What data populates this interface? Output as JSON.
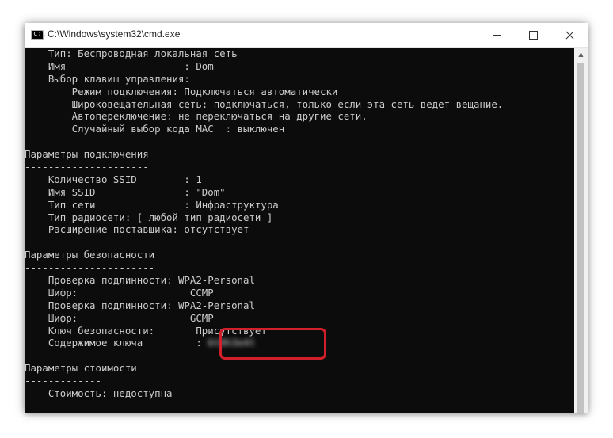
{
  "window": {
    "title": "C:\\Windows\\system32\\cmd.exe",
    "app_icon_glyph": "c:\\",
    "controls": {
      "minimize_icon": "minimize-icon",
      "maximize_icon": "maximize-icon",
      "close_icon": "close-icon"
    }
  },
  "console": {
    "text_color": "#cccccc",
    "background": "#0c0c0c",
    "lines": [
      "    Тип: Беспроводная локальная сеть",
      "    Имя                    : Dom",
      "    Выбор клавиш управления:",
      "        Режим подключения: Подключаться автоматически",
      "        Широковещательная сеть: подключаться, только если эта сеть ведет вещание.",
      "        Автопереключение: не переключаться на другие сети.",
      "        Случайный выбор кода MAC  : выключен",
      "",
      "Параметры подключения",
      "---------------------",
      "    Количество SSID        : 1",
      "    Имя SSID               : \"Dom\"",
      "    Тип сети               : Инфраструктура",
      "    Тип радиосети: [ любой тип радиосети ]",
      "    Расширение поставщика: отсутствует",
      "",
      "Параметры безопасности",
      "----------------------",
      "    Проверка подлинности: WPA2-Personal",
      "    Шифр:                   CCMP",
      "    Проверка подлинности: WPA2-Personal",
      "    Шифр:                   GCMP",
      "    Ключ безопасности:       Присутствует",
      "    Содержимое ключа         : "
    ],
    "key_content_blurred": "6t8h3e4t",
    "cost_section": [
      "",
      "Параметры стоимости",
      "-------------",
      "    Стоимость: недоступна"
    ]
  },
  "annotation": {
    "highlight_color": "#d1202a"
  }
}
